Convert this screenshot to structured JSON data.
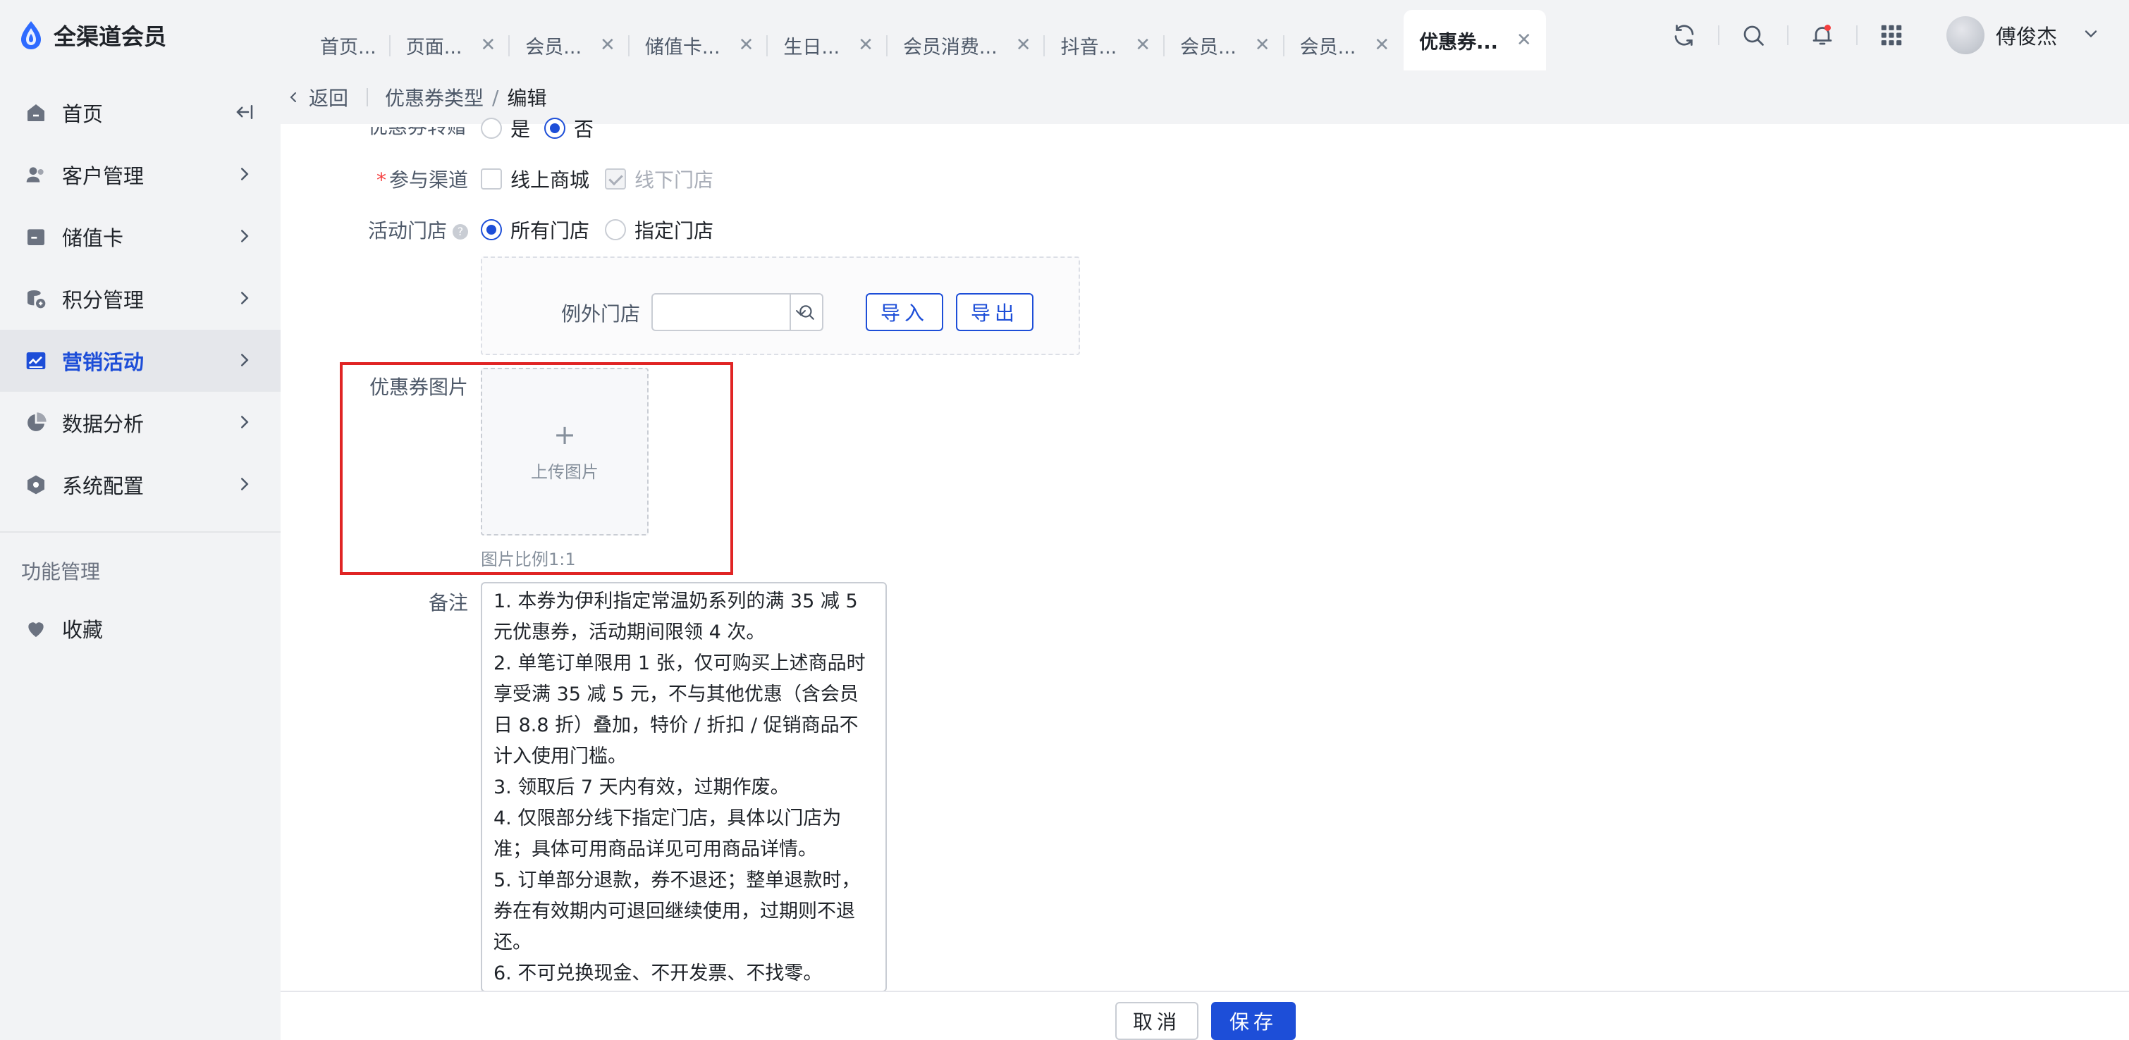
{
  "app": {
    "name": "全渠道会员"
  },
  "tabs": [
    {
      "label": "首页...",
      "closable": false
    },
    {
      "label": "页面...",
      "closable": true
    },
    {
      "label": "会员...",
      "closable": true
    },
    {
      "label": "储值卡...",
      "closable": true
    },
    {
      "label": "生日...",
      "closable": true
    },
    {
      "label": "会员消费...",
      "closable": true
    },
    {
      "label": "抖音...",
      "closable": true
    },
    {
      "label": "会员...",
      "closable": true
    },
    {
      "label": "会员...",
      "closable": true
    },
    {
      "label": "优惠券...",
      "closable": true,
      "active": true
    }
  ],
  "user": {
    "name": "傅俊杰"
  },
  "sidebar": {
    "items": [
      {
        "label": "首页",
        "icon": "home-icon"
      },
      {
        "label": "客户管理",
        "icon": "user-icon"
      },
      {
        "label": "储值卡",
        "icon": "card-icon"
      },
      {
        "label": "积分管理",
        "icon": "points-icon"
      },
      {
        "label": "营销活动",
        "icon": "chart-icon",
        "active": true
      },
      {
        "label": "数据分析",
        "icon": "pie-icon"
      },
      {
        "label": "系统配置",
        "icon": "settings-icon"
      }
    ],
    "section_title": "功能管理",
    "favorites_label": "收藏"
  },
  "breadcrumb": {
    "back": "返回",
    "parent": "优惠券类型",
    "separator": "/",
    "current": "编辑"
  },
  "form": {
    "transfer": {
      "label": "优惠券转赠",
      "yes": "是",
      "no": "否",
      "selected": "否"
    },
    "channel": {
      "label": "参与渠道",
      "online": "线上商城",
      "offline": "线下门店"
    },
    "stores": {
      "label": "活动门店",
      "all": "所有门店",
      "specified": "指定门店",
      "selected": "所有门店"
    },
    "exclude": {
      "label": "例外门店",
      "value": "",
      "import": "导入",
      "export": "导出"
    },
    "image": {
      "label": "优惠券图片",
      "upload": "上传图片",
      "hint": "图片比例1:1"
    },
    "remark": {
      "label": "备注",
      "value": "1. 本券为伊利指定常温奶系列的满 35 减 5 元优惠券，活动期间限领 4 次。\n2. 单笔订单限用 1 张，仅可购买上述商品时享受满 35 减 5 元，不与其他优惠（含会员日 8.8 折）叠加，特价 / 折扣 / 促销商品不计入使用门槛。\n3. 领取后 7 天内有效，过期作废。\n4. 仅限部分线下指定门店，具体以门店为准；具体可用商品详见可用商品详情。\n5. 订单部分退款，券不退还；整单退款时，券在有效期内可退回继续使用，过期则不退还。\n6. 不可兑换现金、不开发票、不找零。"
    }
  },
  "footer": {
    "cancel": "取消",
    "save": "保存"
  },
  "colors": {
    "primary": "#1d4ed8",
    "highlight": "#e02424",
    "required": "#f53f3f",
    "badge": "#f53f3f"
  }
}
